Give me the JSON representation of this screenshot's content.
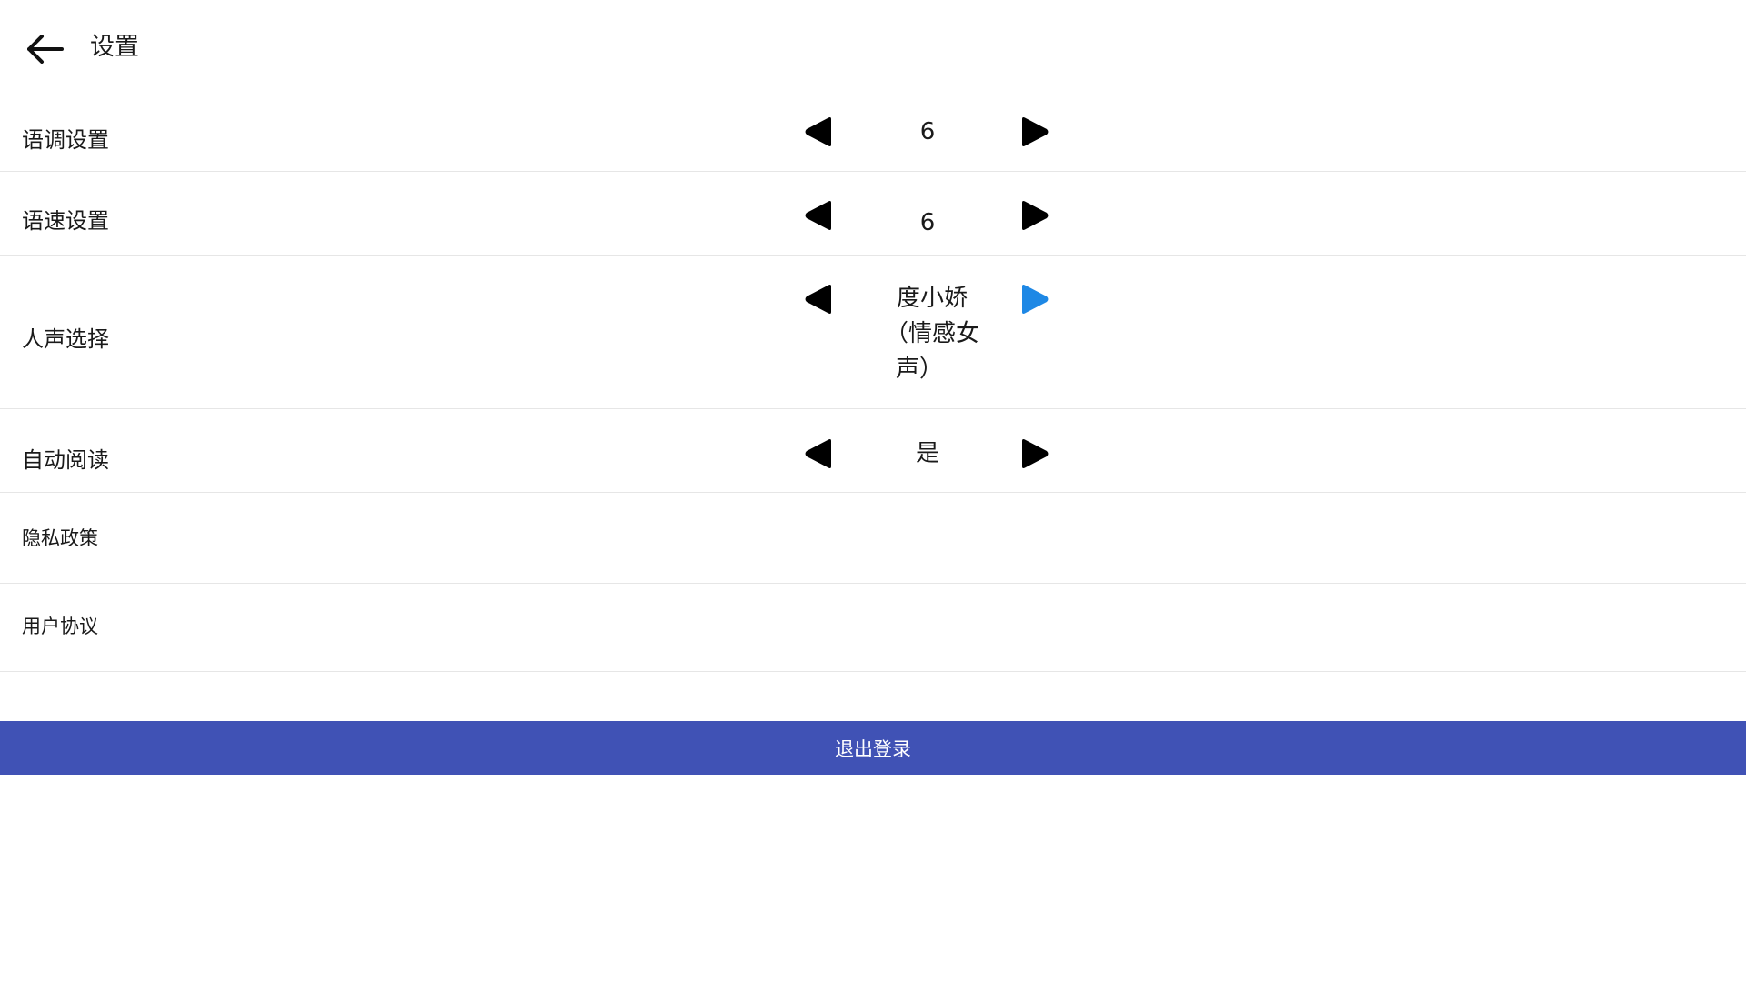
{
  "header": {
    "title": "设置",
    "back_icon": "arrow-left-icon"
  },
  "settings": [
    {
      "label": "语调设置",
      "value": "6"
    },
    {
      "label": "语速设置",
      "value": "6"
    },
    {
      "label": "人声选择",
      "value_lines": [
        "度小娇",
        "（情感女",
        "声）"
      ]
    },
    {
      "label": "自动阅读",
      "value": "是"
    }
  ],
  "links": [
    {
      "label": "隐私政策"
    },
    {
      "label": "用户协议"
    }
  ],
  "logout": {
    "label": "退出登录"
  },
  "colors": {
    "accent": "#4052b5",
    "arrow": "#000000",
    "arrow_active": "#1e88e5",
    "divider": "#e6e6e6"
  },
  "icons": {
    "prev": "triangle-left-icon",
    "next": "triangle-right-icon"
  }
}
